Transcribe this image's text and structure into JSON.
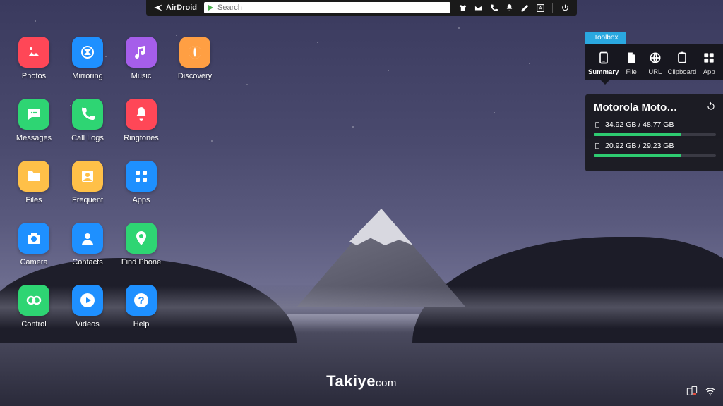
{
  "topbar": {
    "brand": "AirDroid",
    "search_placeholder": "Search"
  },
  "desktop": {
    "apps": [
      {
        "id": "photos",
        "label": "Photos",
        "color": "#ff4757"
      },
      {
        "id": "mirroring",
        "label": "Mirroring",
        "color": "#1e90ff"
      },
      {
        "id": "music",
        "label": "Music",
        "color": "#a55eea"
      },
      {
        "id": "discovery",
        "label": "Discovery",
        "color": "#ff9f43"
      },
      {
        "id": "messages",
        "label": "Messages",
        "color": "#2ed573"
      },
      {
        "id": "calllogs",
        "label": "Call Logs",
        "color": "#2ed573"
      },
      {
        "id": "ringtones",
        "label": "Ringtones",
        "color": "#ff4757"
      },
      {
        "id": "files",
        "label": "Files",
        "color": "#ffc048"
      },
      {
        "id": "frequent",
        "label": "Frequent",
        "color": "#ffc048"
      },
      {
        "id": "apps",
        "label": "Apps",
        "color": "#1e90ff"
      },
      {
        "id": "camera",
        "label": "Camera",
        "color": "#1e90ff"
      },
      {
        "id": "contacts",
        "label": "Contacts",
        "color": "#1e90ff"
      },
      {
        "id": "findphone",
        "label": "Find Phone",
        "color": "#2ed573"
      },
      {
        "id": "control",
        "label": "Control",
        "color": "#2ed573"
      },
      {
        "id": "videos",
        "label": "Videos",
        "color": "#1e90ff"
      },
      {
        "id": "help",
        "label": "Help",
        "color": "#1e90ff"
      }
    ]
  },
  "toolbox": {
    "title": "Toolbox",
    "tools": [
      {
        "id": "summary",
        "label": "Summary"
      },
      {
        "id": "file",
        "label": "File"
      },
      {
        "id": "url",
        "label": "URL"
      },
      {
        "id": "clipboard",
        "label": "Clipboard"
      },
      {
        "id": "app",
        "label": "App"
      }
    ]
  },
  "device": {
    "name": "Motorola Moto…",
    "storage": [
      {
        "kind": "internal",
        "text": "34.92 GB / 48.77 GB",
        "pct": 71.6
      },
      {
        "kind": "sdcard",
        "text": "20.92 GB / 29.23 GB",
        "pct": 71.6
      }
    ]
  },
  "watermark": {
    "bold": "Takiye",
    "thin": "com"
  }
}
